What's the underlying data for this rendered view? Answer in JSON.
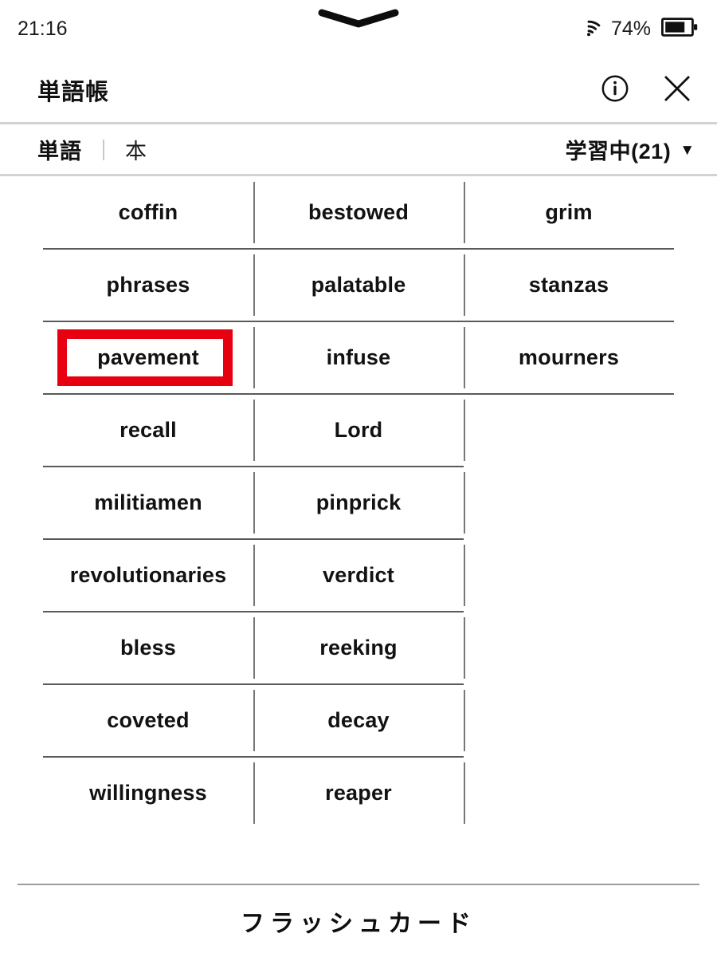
{
  "status_bar": {
    "time": "21:16",
    "battery_percent": "74%",
    "wifi_icon": "wifi-icon",
    "battery_icon": "battery-icon",
    "notch_icon": "notch-chevron-icon"
  },
  "header": {
    "title": "単語帳",
    "info_icon": "info-circle-icon",
    "close_icon": "close-x-icon"
  },
  "filter_bar": {
    "segments": [
      {
        "label": "単語",
        "active": true
      },
      {
        "label": "本",
        "active": false
      }
    ],
    "segment_divider": "｜",
    "status_filter_label": "学習中(21)",
    "caret_icon": "▼"
  },
  "word_grid": {
    "columns": 3,
    "highlighted_word": "pavement",
    "highlight_color": "#e60012",
    "rows": [
      [
        "coffin",
        "bestowed",
        "grim"
      ],
      [
        "phrases",
        "palatable",
        "stanzas"
      ],
      [
        "pavement",
        "infuse",
        "mourners"
      ],
      [
        "recall",
        "Lord",
        ""
      ],
      [
        "militiamen",
        "pinprick",
        ""
      ],
      [
        "revolutionaries",
        "verdict",
        ""
      ],
      [
        "bless",
        "reeking",
        ""
      ],
      [
        "coveted",
        "decay",
        ""
      ],
      [
        "willingness",
        "reaper",
        ""
      ]
    ]
  },
  "footer": {
    "action_label": "フラッシュカード"
  }
}
